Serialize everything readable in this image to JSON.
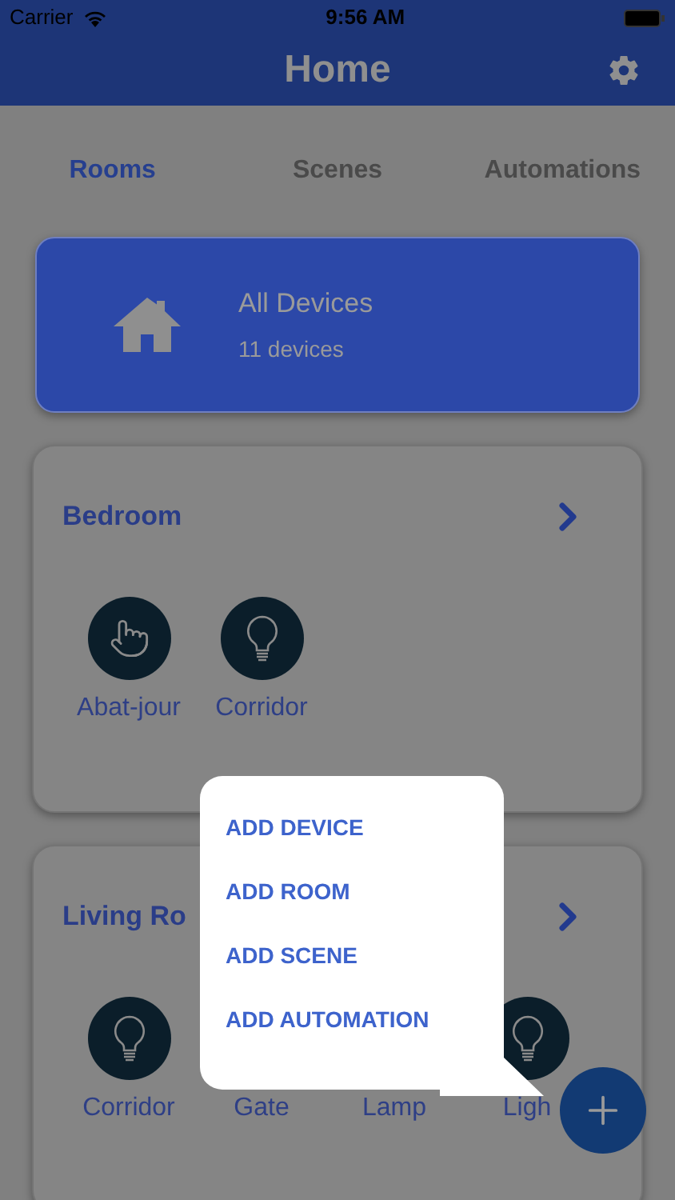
{
  "status_bar": {
    "carrier": "Carrier",
    "time": "9:56 AM"
  },
  "header": {
    "title": "Home"
  },
  "tabs": [
    {
      "label": "Rooms",
      "selected": true
    },
    {
      "label": "Scenes",
      "selected": false
    },
    {
      "label": "Automations",
      "selected": false
    }
  ],
  "all_devices": {
    "title": "All Devices",
    "count": "11 devices"
  },
  "rooms": [
    {
      "name": "Bedroom",
      "devices": [
        {
          "name": "Abat-jour",
          "kind": "touch"
        },
        {
          "name": "Corridor",
          "kind": "bulb"
        }
      ]
    },
    {
      "name": "Living Ro",
      "devices": [
        {
          "name": "Corridor",
          "kind": "bulb"
        },
        {
          "name": "Gate",
          "kind": "hidden"
        },
        {
          "name": "Lamp",
          "kind": "hidden"
        },
        {
          "name": "Ligh",
          "kind": "bulb"
        }
      ]
    }
  ],
  "menu": [
    "ADD DEVICE",
    "ADD ROOM",
    "ADD SCENE",
    "ADD AUTOMATION"
  ]
}
